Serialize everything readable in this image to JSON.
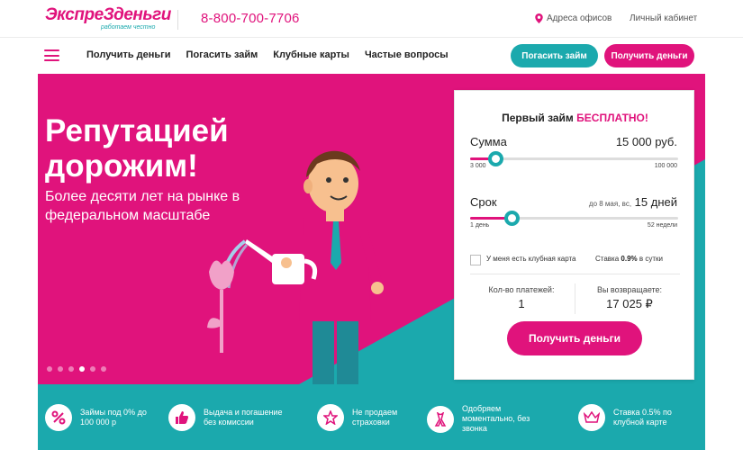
{
  "header": {
    "logo_text": "ЭкспреЗденьги",
    "logo_tagline": "работаем честно",
    "phone": "8-800-700-7706",
    "offices_label": "Адреса офисов",
    "cabinet_label": "Личный кабинет"
  },
  "nav": {
    "items": [
      {
        "label": "Получить деньги"
      },
      {
        "label": "Погасить займ"
      },
      {
        "label": "Клубные карты"
      },
      {
        "label": "Частые вопросы"
      }
    ],
    "pay_button": "Погасить займ",
    "get_button": "Получить деньги"
  },
  "hero": {
    "title": "Репутацией дорожим!",
    "subtitle": "Более десяти лет на рынке в федеральном масштабе",
    "slides_count": 6,
    "active_slide": 4
  },
  "calculator": {
    "title_prefix": "Первый займ",
    "title_highlight": "БЕСПЛАТНО!",
    "amount": {
      "label": "Сумма",
      "value": "15 000 руб.",
      "min": "3 000",
      "max": "100 000",
      "position": 0.12
    },
    "term": {
      "label": "Срок",
      "note": "до 8 мая, вс,",
      "value": "15 дней",
      "min": "1 день",
      "max": "52 недели",
      "position": 0.2
    },
    "club_card_label": "У меня есть клубная карта",
    "rate_prefix": "Ставка",
    "rate_value": "0.9%",
    "rate_suffix": "в сутки",
    "payments_label": "Кол-во платежей:",
    "payments_value": "1",
    "return_label": "Вы возвращаете:",
    "return_value": "17 025 ₽",
    "submit_label": "Получить деньги"
  },
  "features": [
    {
      "icon": "percent-icon",
      "text": "Займы под 0% до 100 000 р"
    },
    {
      "icon": "thumbs-up-icon",
      "text": "Выдача и погашение без комиссии"
    },
    {
      "icon": "star-icon",
      "text": "Не продаем страховки"
    },
    {
      "icon": "ribbon-icon",
      "text": "Одобряем моментально, без звонка"
    },
    {
      "icon": "crown-icon",
      "text": "Ставка 0.5% по клубной карте"
    }
  ],
  "colors": {
    "brand_pink": "#e0137c",
    "brand_teal": "#1ba9ad"
  }
}
